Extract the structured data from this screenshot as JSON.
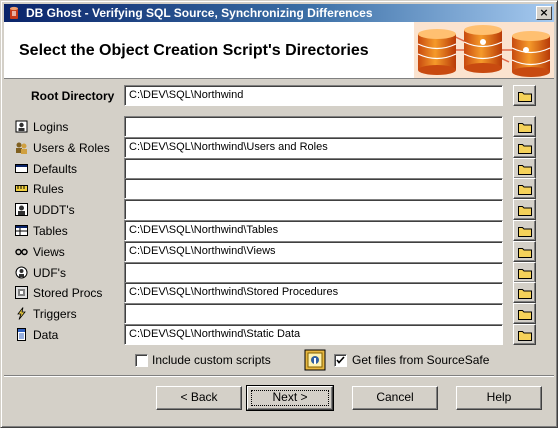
{
  "window": {
    "title": "DB Ghost - Verifying SQL Source, Synchronizing Differences",
    "close_glyph": "×"
  },
  "header": {
    "title": "Select the Object Creation Script's Directories"
  },
  "root": {
    "label": "Root Directory",
    "value": "C:\\DEV\\SQL\\Northwind"
  },
  "rows": [
    {
      "label": "Logins",
      "value": "",
      "icon": "logins-icon"
    },
    {
      "label": "Users & Roles",
      "value": "C:\\DEV\\SQL\\Northwind\\Users and Roles",
      "icon": "users-roles-icon"
    },
    {
      "label": "Defaults",
      "value": "",
      "icon": "defaults-icon"
    },
    {
      "label": "Rules",
      "value": "",
      "icon": "rules-icon"
    },
    {
      "label": "UDDT's",
      "value": "",
      "icon": "uddt-icon"
    },
    {
      "label": "Tables",
      "value": "C:\\DEV\\SQL\\Northwind\\Tables",
      "icon": "table-icon"
    },
    {
      "label": "Views",
      "value": "C:\\DEV\\SQL\\Northwind\\Views",
      "icon": "views-icon"
    },
    {
      "label": "UDF's",
      "value": "",
      "icon": "udf-icon"
    },
    {
      "label": "Stored Procs",
      "value": "C:\\DEV\\SQL\\Northwind\\Stored Procedures",
      "icon": "stored-procs-icon"
    },
    {
      "label": "Triggers",
      "value": "",
      "icon": "triggers-icon"
    },
    {
      "label": "Data",
      "value": "C:\\DEV\\SQL\\Northwind\\Static Data",
      "icon": "data-icon"
    }
  ],
  "options": {
    "include_custom_scripts": {
      "label": "Include custom scripts",
      "checked": false
    },
    "get_from_sourcesafe": {
      "label": "Get files from SourceSafe",
      "checked": true
    }
  },
  "buttons": {
    "back": "< Back",
    "next": "Next >",
    "cancel": "Cancel",
    "help": "Help"
  },
  "colors": {
    "titlebar_start": "#0a246a",
    "titlebar_end": "#a6caf0",
    "face": "#d4d0c8",
    "folder": "#f5d25a",
    "logo_cylinder": "#f08a1a"
  }
}
